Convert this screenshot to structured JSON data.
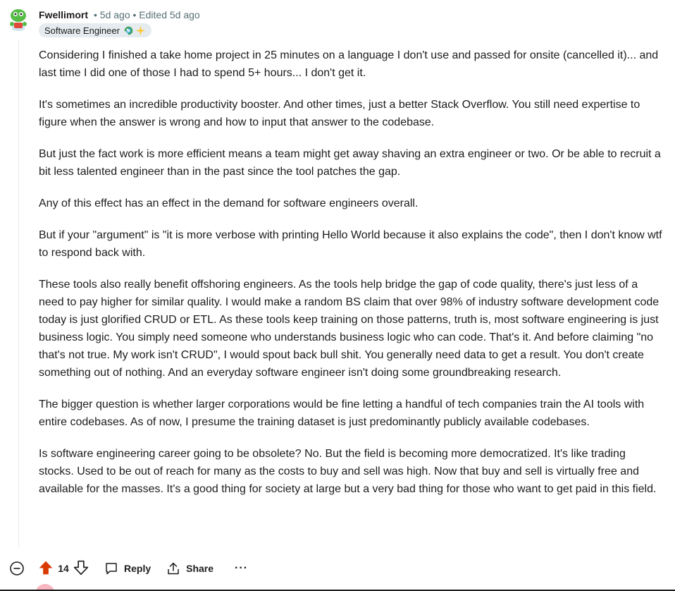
{
  "comment": {
    "username": "Fwellimort",
    "meta": "• 5d ago • Edited 5d ago",
    "flair": "Software Engineer",
    "paragraphs": [
      "Considering I finished a take home project in 25 minutes on a language I don't use and passed for onsite (cancelled it)... and last time I did one of those I had to spend 5+ hours... I don't get it.",
      "It's sometimes an incredible productivity booster. And other times, just a better Stack Overflow. You still need expertise to figure when the answer is wrong and how to input that answer to the codebase.",
      "But just the fact work is more efficient means a team might get away shaving an extra engineer or two. Or be able to recruit a bit less talented engineer than in the past since the tool patches the gap.",
      "Any of this effect has an effect in the demand for software engineers overall.",
      "But if your \"argument\" is \"it is more verbose with printing Hello World because it also explains the code\", then I don't know wtf to respond back with.",
      "These tools also really benefit offshoring engineers. As the tools help bridge the gap of code quality, there's just less of a need to pay higher for similar quality. I would make a random BS claim that over 98% of industry software development code today is just glorified CRUD or ETL. As these tools keep training on those patterns, truth is, most software engineering is just business logic. You simply need someone who understands business logic who can code. That's it. And before claiming \"no that's not true. My work isn't CRUD\", I would spout back bull shit. You generally need data to get a result. You don't create something out of nothing. And an everyday software engineer isn't doing some groundbreaking research.",
      "The bigger question is whether larger corporations would be fine letting a handful of tech companies train the AI tools with entire codebases. As of now, I presume the training dataset is just predominantly publicly available codebases.",
      "Is software engineering career going to be obsolete? No. But the field is becoming more democratized. It's like trading stocks. Used to be out of reach for many as the costs to buy and sell was high. Now that buy and sell is virtually free and available for the masses. It's a good thing for society at large but a very bad thing for those who want to get paid in this field."
    ]
  },
  "actions": {
    "vote_count": "14",
    "reply_label": "Reply",
    "share_label": "Share",
    "more_label": "···"
  },
  "colors": {
    "upvote": "#d93a00",
    "meta": "#576f76",
    "flair_bg": "#e5ebee"
  },
  "icons": [
    "collapse-icon",
    "upvote-icon",
    "downvote-icon",
    "reply-icon",
    "share-icon",
    "more-icon",
    "flair-emoji-icon",
    "sparkle-icon"
  ]
}
